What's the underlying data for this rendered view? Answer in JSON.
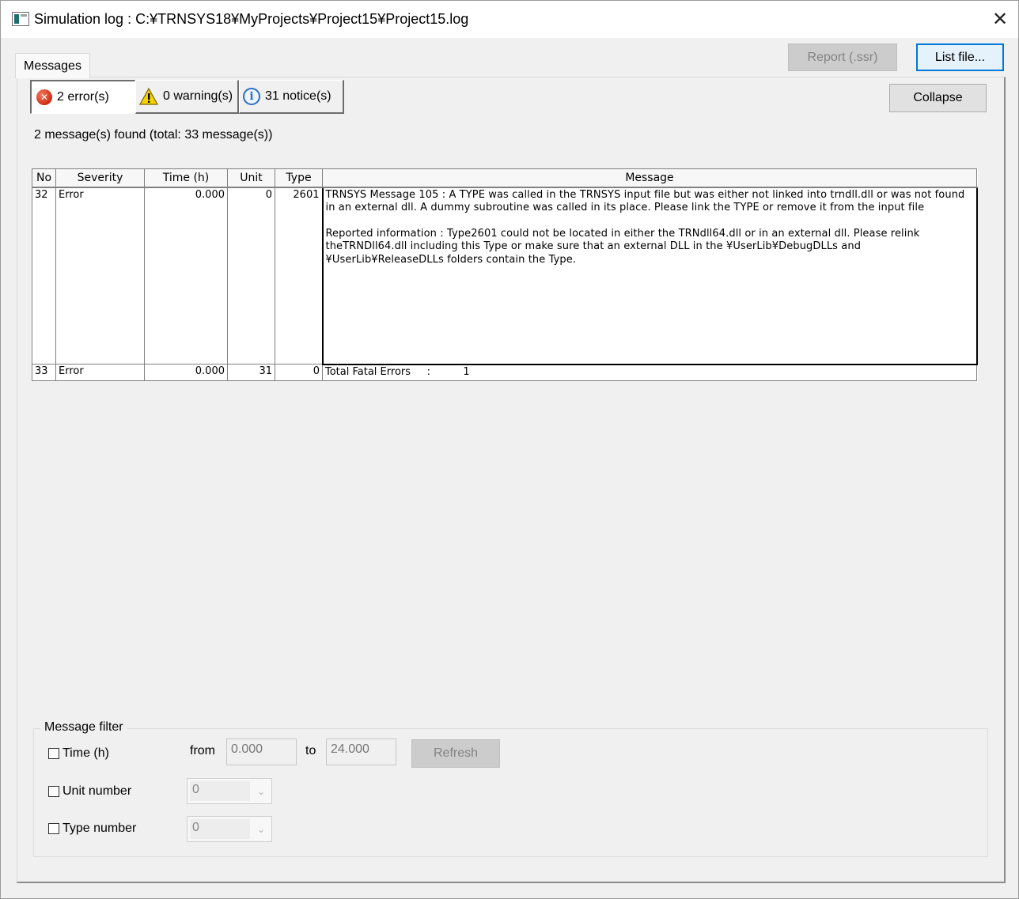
{
  "window": {
    "title": "Simulation log : C:¥TRNSYS18¥MyProjects¥Project15¥Project15.log",
    "close_glyph": "✕"
  },
  "tabs": {
    "messages": "Messages"
  },
  "buttons": {
    "report": "Report (.ssr)",
    "list_file": "List file...",
    "collapse": "Collapse",
    "refresh": "Refresh"
  },
  "filters": {
    "errors": "2 error(s)",
    "warnings": "0 warning(s)",
    "notices": "31 notice(s)"
  },
  "summary": "2 message(s) found (total: 33 message(s))",
  "table": {
    "headers": {
      "no": "No",
      "severity": "Severity",
      "time": "Time (h)",
      "unit": "Unit",
      "type": "Type",
      "message": "Message"
    },
    "rows": [
      {
        "no": "32",
        "severity": "Error",
        "time": "0.000",
        "unit": "0",
        "type": "2601",
        "message_line1": "TRNSYS Message    105 : A TYPE was called in the TRNSYS input file but was either not linked into trndll.dll or was not found in an external dll. A dummy subroutine was called in its place. Please link the TYPE or remove it from the input file",
        "message_line2": "Reported information  :  Type2601 could not be located in either the TRNdll64.dll or in an external dll. Please relink theTRNDll64.dll including this Type or make sure that an external DLL in the ¥UserLib¥DebugDLLs and ¥UserLib¥ReleaseDLLs folders contain the Type."
      },
      {
        "no": "33",
        "severity": "Error",
        "time": "0.000",
        "unit": "31",
        "type": "0",
        "message_line1": "Total Fatal Errors     :          1"
      }
    ]
  },
  "message_filter": {
    "group_label": "Message filter",
    "time_label": "Time (h)",
    "from_label": "from",
    "from_value": "0.000",
    "to_label": "to",
    "to_value": "24.000",
    "unit_label": "Unit number",
    "unit_value": "0",
    "type_label": "Type number",
    "type_value": "0",
    "dropdown_glyph": "⌄"
  }
}
